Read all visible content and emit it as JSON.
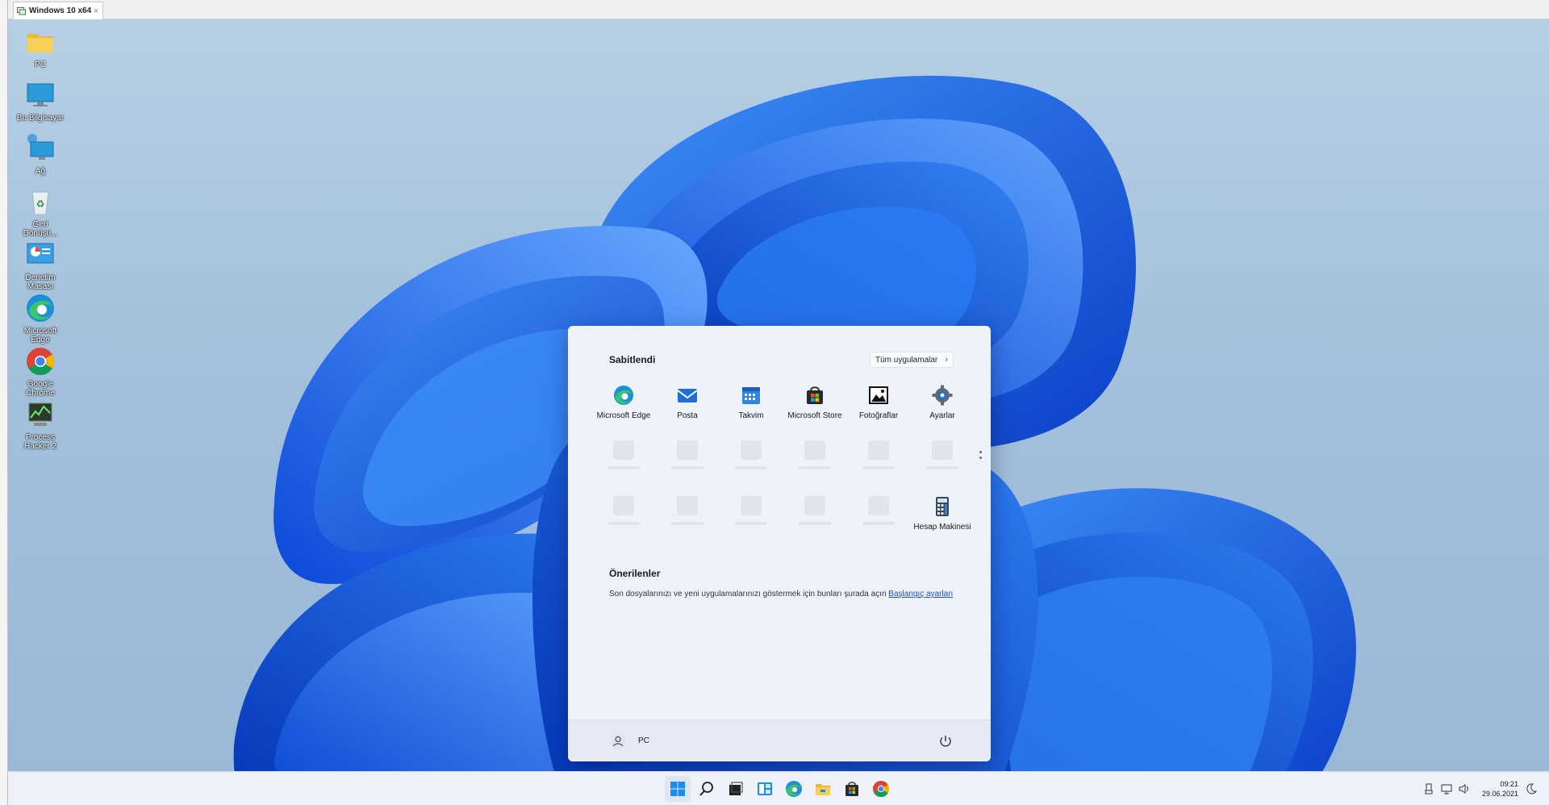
{
  "host": {
    "tab_title": "Windows 10 x64",
    "tab_close": "×"
  },
  "desktop": {
    "icons": [
      {
        "label": "PC"
      },
      {
        "label": "Bu Bilgisayar"
      },
      {
        "label": "Ağ"
      },
      {
        "label": "Geri Dönüşü..."
      },
      {
        "label": "Denetim Masası"
      },
      {
        "label": "Microsoft Edge"
      },
      {
        "label": "Google Chrome"
      },
      {
        "label": "Process Hacker 2"
      }
    ]
  },
  "start_menu": {
    "pinned_title": "Sabitlendi",
    "all_apps_label": "Tüm uygulamalar",
    "all_apps_chevron": "›",
    "pinned_apps": [
      {
        "label": "Microsoft Edge",
        "icon": "edge-icon"
      },
      {
        "label": "Posta",
        "icon": "mail-icon"
      },
      {
        "label": "Takvim",
        "icon": "calendar-icon"
      },
      {
        "label": "Microsoft Store",
        "icon": "store-icon"
      },
      {
        "label": "Fotoğraflar",
        "icon": "photos-icon"
      },
      {
        "label": "Ayarlar",
        "icon": "settings-icon"
      },
      {
        "label": "Hesap Makinesi",
        "icon": "calculator-icon"
      }
    ],
    "recommended_title": "Önerilenler",
    "recommended_text": "Son dosyalarınızı ve yeni uygulamalarınızı göstermek için bunları şurada açın",
    "recommended_link": "Başlangıç ayarları",
    "user_name": "PC"
  },
  "taskbar": {
    "buttons": [
      "start-icon",
      "search-icon",
      "task-view-icon",
      "widgets-icon",
      "edge-icon",
      "file-explorer-icon",
      "store-icon",
      "chrome-icon"
    ]
  },
  "tray": {
    "time": "09:21",
    "date": "29.06.2021"
  },
  "colors": {
    "accent": "#0067c0",
    "wallpaper_bg": "#a4c1dc",
    "bloom_blue": "#1a6cf0"
  }
}
